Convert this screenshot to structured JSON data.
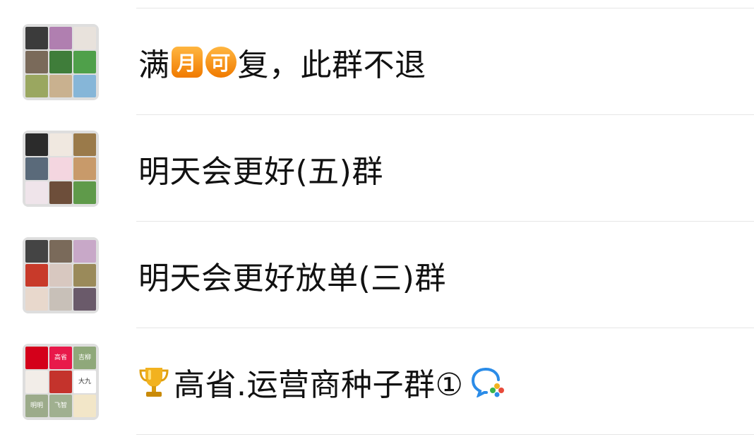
{
  "chats": [
    {
      "name": "满月可复，此群不退",
      "name_parts": [
        "满",
        "月",
        "可",
        "复，此群不退"
      ],
      "avatar_tiles": [
        "#3b3b3b",
        "#b07fb0",
        "#e8e2dc",
        "#7a6a5a",
        "#3f7d3a",
        "#4fa04a",
        "#9aa760",
        "#c9b18f",
        "#86b6d8"
      ]
    },
    {
      "name": "明天会更好(五)群",
      "avatar_tiles": [
        "#2b2b2b",
        "#f0e8e0",
        "#9a7a4a",
        "#5a6a7a",
        "#f4d6e0",
        "#c89a6a",
        "#efe4ea",
        "#6d4e3a",
        "#5f9a4a"
      ]
    },
    {
      "name": "明天会更好放单(三)群",
      "avatar_tiles": [
        "#444444",
        "#7a6a5a",
        "#c8a8c8",
        "#c83a2a",
        "#d8c8c0",
        "#9a8a5a",
        "#e8d8cc",
        "#c8c0b8",
        "#6a5a6a"
      ]
    },
    {
      "name": "高省.运营商种子群①",
      "avatar_tiles": [
        "#d4001a",
        "#e8194a",
        "#8fa87a",
        "#f2ede8",
        "#c4332c",
        "#ffffff",
        "#9cab8a",
        "#a0b090",
        "#f2e6c8"
      ],
      "avatar_labels": [
        "",
        "高省",
        "吉柳",
        "",
        "",
        "大九",
        "明明",
        "飞智",
        ""
      ]
    }
  ]
}
